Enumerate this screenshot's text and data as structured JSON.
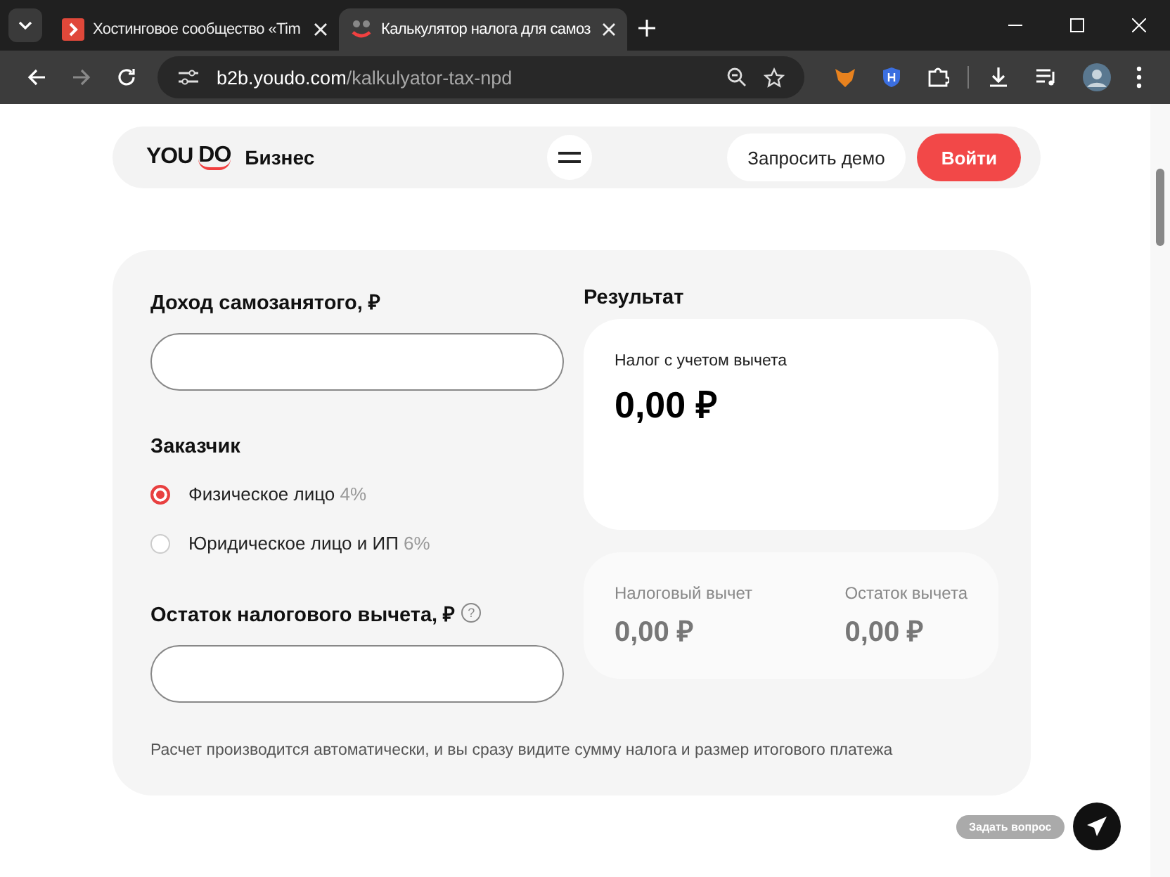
{
  "browser": {
    "tabs": [
      {
        "title": "Хостинговое сообщество «Tim",
        "selected": false
      },
      {
        "title": "Калькулятор налога для самоз",
        "selected": true
      }
    ],
    "url_host": "b2b.youdo.com",
    "url_path": "/kalkulyator-tax-npd"
  },
  "header": {
    "logo_left": "YOU",
    "logo_right": "DO",
    "logo_suffix": "Бизнес",
    "demo_button": "Запросить демо",
    "login_button": "Войти"
  },
  "calculator": {
    "income_label": "Доход самозанятого, ₽",
    "customer_label": "Заказчик",
    "customers": [
      {
        "label": "Физическое лицо",
        "rate": "4%",
        "selected": true
      },
      {
        "label": "Юридическое лицо и ИП",
        "rate": "6%",
        "selected": false
      }
    ],
    "deduction_label": "Остаток налогового вычета, ₽",
    "help_mark": "?",
    "result_title": "Результат",
    "tax_label": "Налог с учетом вычета",
    "tax_value": "0,00 ₽",
    "stats": [
      {
        "label": "Налоговый вычет",
        "value": "0,00 ₽"
      },
      {
        "label": "Остаток вычета",
        "value": "0,00 ₽"
      }
    ],
    "note": "Расчет производится автоматически, и вы сразу видите сумму налога и размер итогового платежа"
  },
  "chat": {
    "label": "Задать вопрос"
  }
}
